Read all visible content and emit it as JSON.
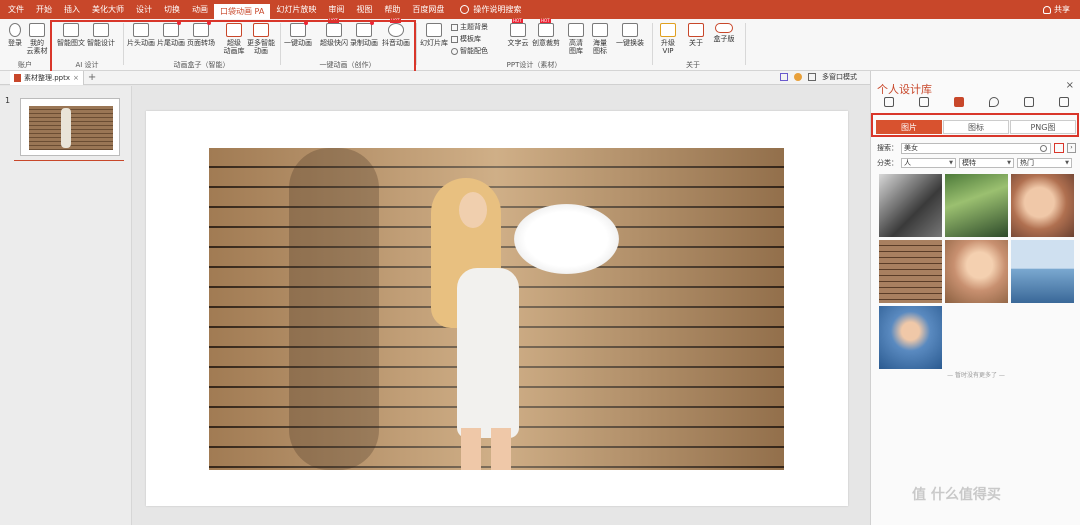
{
  "menubar": {
    "items": [
      "文件",
      "开始",
      "插入",
      "美化大师",
      "设计",
      "切换",
      "动画",
      "口袋动画 PA",
      "幻灯片放映",
      "审阅",
      "视图",
      "帮助",
      "百度网盘"
    ],
    "active_index": 7,
    "search_label": "操作说明搜索",
    "share_label": "共享",
    "accent_color": "#c8472a"
  },
  "ribbon": {
    "account": {
      "login": "登录",
      "cloud": "我的\n云素材",
      "label": "账户"
    },
    "ai": {
      "btn1": "智能图文",
      "btn2": "智能设计",
      "label": "AI 设计"
    },
    "anim_box": {
      "btn1": "片头动画",
      "btn2": "片尾动画",
      "btn3": "页面转场",
      "btn4": "超级\n动画库",
      "btn5": "更多智能\n动画",
      "label": "动画盒子（智能）"
    },
    "one_anim": {
      "btn1": "一键动画",
      "btn2": "超级快闪",
      "btn3": "录制动画",
      "btn4": "抖音动画",
      "label": "一键动画（创作）"
    },
    "ppt": {
      "btn1": "幻灯片库",
      "small1": "主题背景",
      "small2": "模板库",
      "small3": "智能配色",
      "btn2": "文字云",
      "btn3": "创意裁剪",
      "btn4": "高清\n图库",
      "btn5": "海量\n图标",
      "btn6": "一键换装",
      "label": "PPT设计（素材）"
    },
    "about": {
      "btn1": "升级\nVIP",
      "btn2": "关于",
      "btn3": "盒子版",
      "label": "关于"
    }
  },
  "filebar": {
    "tab_name": "素材整理.pptx",
    "close": "×",
    "add": "+",
    "multi_window": "多窗口模式"
  },
  "thumbs": {
    "slide_number": "1"
  },
  "panel": {
    "title": "个人设计库",
    "close": "×",
    "tabs": [
      "图片",
      "图标",
      "PNG图"
    ],
    "active_tab": 0,
    "search_label": "搜索：",
    "search_value": "美女",
    "class_label": "分类：",
    "class_options": [
      "人",
      "模特",
      "热门"
    ],
    "no_more": "— 暂时没有更多了 —"
  },
  "watermark": "值 什么值得买"
}
